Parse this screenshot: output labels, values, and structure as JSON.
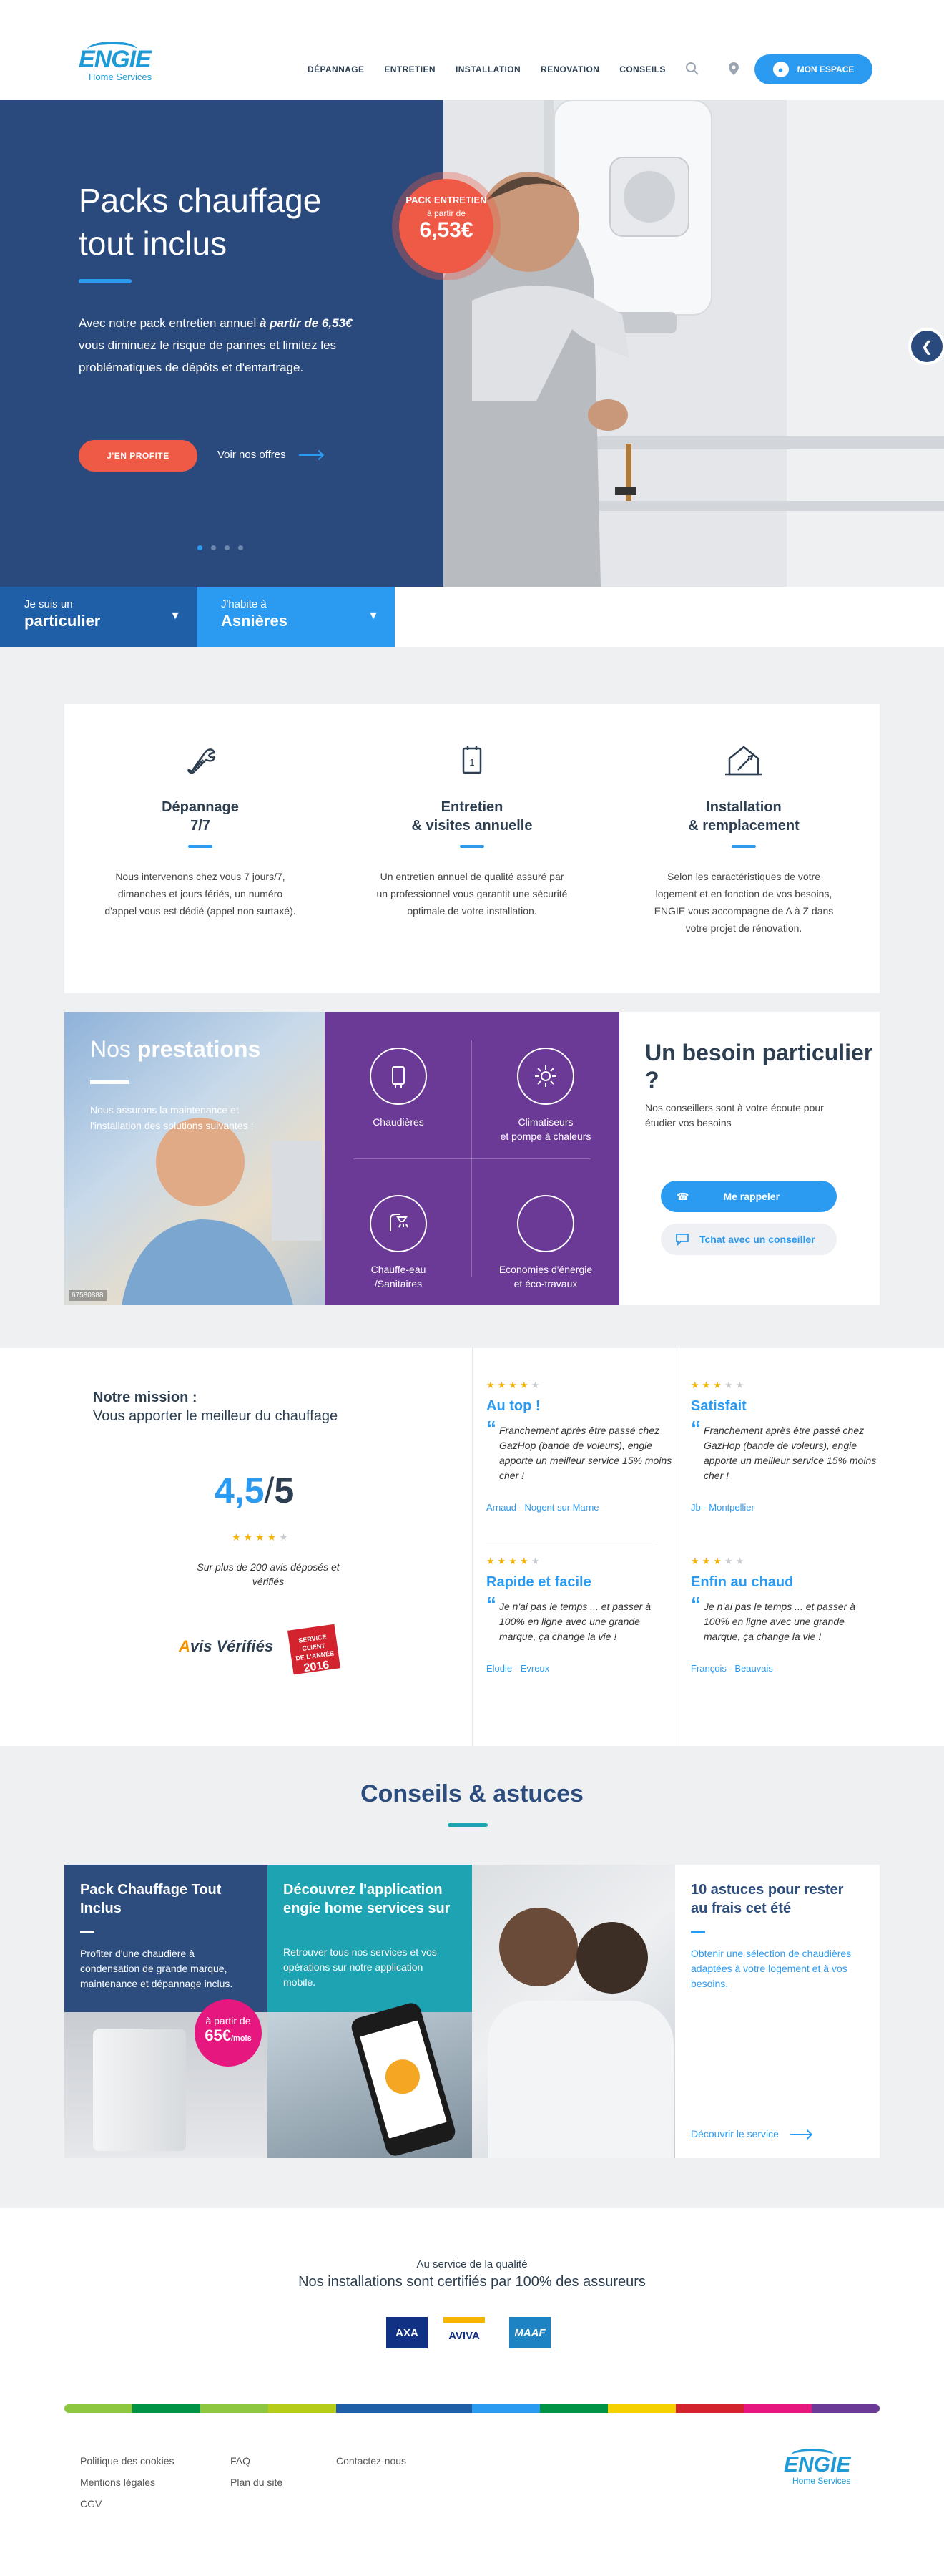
{
  "header": {
    "logo_brand": "ENGIE",
    "logo_sub": "Home Services",
    "nav": [
      "DÉPANNAGE",
      "ENTRETIEN",
      "INSTALLATION",
      "RENOVATION",
      "CONSEILS"
    ],
    "espace_label": "MON ESPACE",
    "icons": [
      "search-icon",
      "location-pin-icon",
      "user-icon"
    ]
  },
  "hero": {
    "title": "Packs chauffage tout inclus",
    "text_before": "Avec notre pack entretien annuel ",
    "text_highlight": "à partir de 6,53€",
    "text_after": " vous diminuez le risque de pannes et limitez les problématiques de dépôts et d'entartrage.",
    "cta": "J'EN PROFITE",
    "link": "Voir nos offres",
    "badge": {
      "line1": "PACK ENTRETIEN",
      "line2": "à partir de",
      "price": "6,53€"
    },
    "slides": 4,
    "active_slide": 1
  },
  "selectors": [
    {
      "small": "Je suis un",
      "big": "particulier"
    },
    {
      "small": "J'habite à",
      "big": "Asnières"
    }
  ],
  "services": [
    {
      "title": "Dépannage\n7/7",
      "text": "Nous intervenons chez vous 7 jours/7, dimanches et jours fériés, un numéro d'appel vous est dédié (appel non surtaxé).",
      "icon": "wrench-icon"
    },
    {
      "title": "Entretien\n& visites annuelle",
      "text": "Un entretien annuel de qualité assuré par un professionnel vous garantit une sécurité optimale de votre installation.",
      "icon": "calendar-icon"
    },
    {
      "title": "Installation\n& remplacement",
      "text": "Selon les caractéristiques de votre logement et en fonction de vos besoins, ENGIE vous accompagne de A à Z dans votre projet de rénovation.",
      "icon": "house-tools-icon"
    }
  ],
  "prestations": {
    "title_light": "Nos ",
    "title_bold": "prestations",
    "text": "Nous assurons la maintenance et l'installation des solutions suivantes :",
    "credit": "67580888",
    "items": [
      {
        "label": "Chaudières",
        "icon": "boiler-icon"
      },
      {
        "label": "Climatiseurs\net pompe à chaleurs",
        "icon": "climate-icon"
      },
      {
        "label": "Chauffe-eau\n/Sanitaires",
        "icon": "shower-icon"
      },
      {
        "label": "Economies d'énergie\net éco-travaux",
        "icon": "leaf-icon"
      }
    ]
  },
  "besoin": {
    "title": "Un besoin particulier ?",
    "text": "Nos conseillers sont à votre écoute pour étudier vos besoins",
    "btn_call": "Me rappeler",
    "btn_chat": "Tchat avec un conseiller"
  },
  "mission": {
    "title": "Notre mission :",
    "subtitle": "Vous apporter le meilleur du chauffage",
    "score_a": "4,5",
    "score_sep": "/",
    "score_b": "5",
    "rating": 4,
    "reviews_text": "Sur plus de 200 avis déposés et vérifiés",
    "avis_logo": "Avis Vérifiés",
    "award": {
      "line1": "SERVICE CLIENT",
      "line2": "DE L'ANNÉE",
      "year": "2016"
    }
  },
  "reviews": [
    {
      "stars": 4,
      "title": "Au top !",
      "text": "Franchement après être passé chez GazHop (bande de voleurs), engie apporte un meilleur service 15% moins cher !",
      "author": "Arnaud - Nogent sur Marne"
    },
    {
      "stars": 3,
      "title": "Satisfait",
      "text": "Franchement après être passé chez GazHop (bande de voleurs), engie apporte un meilleur service 15% moins cher !",
      "author": "Jb - Montpellier"
    },
    {
      "stars": 4,
      "title": "Rapide et facile",
      "text": "Je n'ai pas le temps ... et passer à 100% en ligne avec une grande marque, ça change la vie !",
      "author": "Elodie - Evreux"
    },
    {
      "stars": 3,
      "title": "Enfin au chaud",
      "text": "Je n'ai pas le temps ... et passer à 100% en ligne avec une grande marque, ça change la vie !",
      "author": "François - Beauvais"
    }
  ],
  "conseils": {
    "title": "Conseils & astuces",
    "cards": [
      {
        "title": "Pack Chauffage Tout Inclus",
        "text": "Profiter d'une chaudière à condensation de grande marque, maintenance et dépannage inclus.",
        "badge_line1": "à partir de",
        "badge_price": "65€",
        "badge_unit": "/mois"
      },
      {
        "title": "Découvrez l'application engie home services sur",
        "text": "Retrouver tous nos services et vos opérations sur notre application mobile."
      },
      {
        "title": "10 astuces pour rester au frais cet été",
        "text": "Obtenir une sélection de chaudières adaptées à votre logement et à vos besoins.",
        "link": "Découvrir le service"
      }
    ]
  },
  "assureurs": {
    "small": "Au service de la qualité",
    "big": "Nos installations sont certifiés par 100% des assureurs",
    "logos": [
      "AXA",
      "AVIVA",
      "MAAF"
    ]
  },
  "footer": {
    "col1": [
      "Politique des cookies",
      "Mentions légales",
      "CGV"
    ],
    "col2": [
      "FAQ",
      "Plan du site"
    ],
    "col3": [
      "Contactez-nous"
    ],
    "logo_brand": "ENGIE",
    "logo_sub": "Home Services",
    "colors": [
      "#8dc63f",
      "#009245",
      "#8dc63f",
      "#b5cc18",
      "#1f5fa8",
      "#1f5fa8",
      "#2b9bf2",
      "#009245",
      "#f5d100",
      "#d3232f",
      "#e6177e",
      "#6b3a96"
    ]
  }
}
